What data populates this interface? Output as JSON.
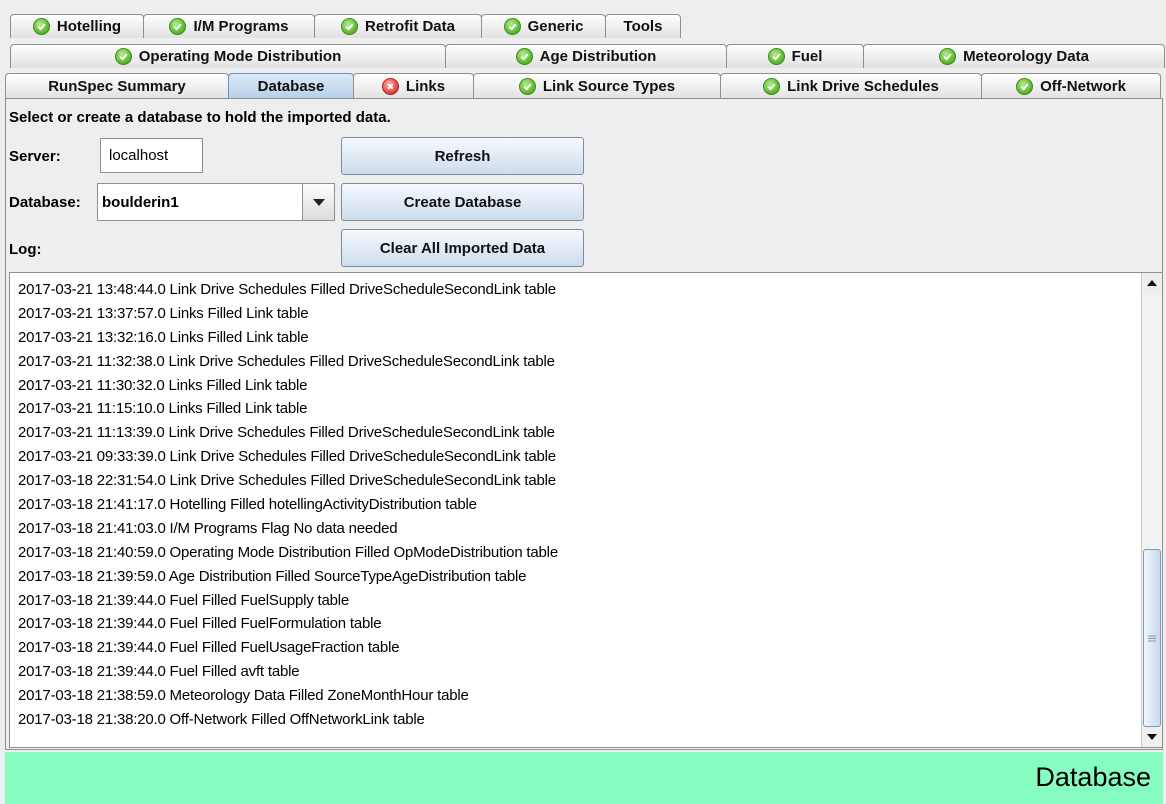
{
  "tabs": {
    "row1": [
      {
        "label": "Hotelling",
        "icon": "ok"
      },
      {
        "label": "I/M Programs",
        "icon": "ok"
      },
      {
        "label": "Retrofit Data",
        "icon": "ok"
      },
      {
        "label": "Generic",
        "icon": "ok"
      },
      {
        "label": "Tools",
        "icon": ""
      }
    ],
    "row2": [
      {
        "label": "Operating Mode Distribution",
        "icon": "ok"
      },
      {
        "label": "Age Distribution",
        "icon": "ok"
      },
      {
        "label": "Fuel",
        "icon": "ok"
      },
      {
        "label": "Meteorology Data",
        "icon": "ok"
      }
    ],
    "row3": [
      {
        "label": "RunSpec Summary",
        "icon": ""
      },
      {
        "label": "Database",
        "icon": "",
        "selected": true
      },
      {
        "label": "Links",
        "icon": "err"
      },
      {
        "label": "Link Source Types",
        "icon": "ok"
      },
      {
        "label": "Link Drive Schedules",
        "icon": "ok"
      },
      {
        "label": "Off-Network",
        "icon": "ok"
      }
    ]
  },
  "form": {
    "instruction": "Select or create a database to hold the imported data.",
    "server_label": "Server:",
    "server_value": "localhost",
    "database_label": "Database:",
    "database_value": "boulderin1",
    "log_label": "Log:",
    "refresh_button": "Refresh",
    "create_button": "Create Database",
    "clear_button": "Clear All Imported Data"
  },
  "log": [
    "2017-03-21 13:48:44.0 Link Drive Schedules Filled DriveScheduleSecondLink table",
    "2017-03-21 13:37:57.0 Links Filled Link table",
    "2017-03-21 13:32:16.0 Links Filled Link table",
    "2017-03-21 11:32:38.0 Link Drive Schedules Filled DriveScheduleSecondLink table",
    "2017-03-21 11:30:32.0 Links Filled Link table",
    "2017-03-21 11:15:10.0 Links Filled Link table",
    "2017-03-21 11:13:39.0 Link Drive Schedules Filled DriveScheduleSecondLink table",
    "2017-03-21 09:33:39.0 Link Drive Schedules Filled DriveScheduleSecondLink table",
    "2017-03-18 22:31:54.0 Link Drive Schedules Filled DriveScheduleSecondLink table",
    "2017-03-18 21:41:17.0 Hotelling Filled hotellingActivityDistribution table",
    "2017-03-18 21:41:03.0 I/M Programs Flag No data needed",
    "2017-03-18 21:40:59.0 Operating Mode Distribution Filled OpModeDistribution table",
    "2017-03-18 21:39:59.0 Age Distribution Filled SourceTypeAgeDistribution table",
    "2017-03-18 21:39:44.0 Fuel Filled FuelSupply table",
    "2017-03-18 21:39:44.0 Fuel Filled FuelFormulation table",
    "2017-03-18 21:39:44.0 Fuel Filled FuelUsageFraction table",
    "2017-03-18 21:39:44.0 Fuel Filled avft table",
    "2017-03-18 21:38:59.0 Meteorology Data Filled ZoneMonthHour table",
    "2017-03-18 21:38:20.0 Off-Network Filled OffNetworkLink table"
  ],
  "status": {
    "text": "Database",
    "color": "#86fcc0"
  }
}
